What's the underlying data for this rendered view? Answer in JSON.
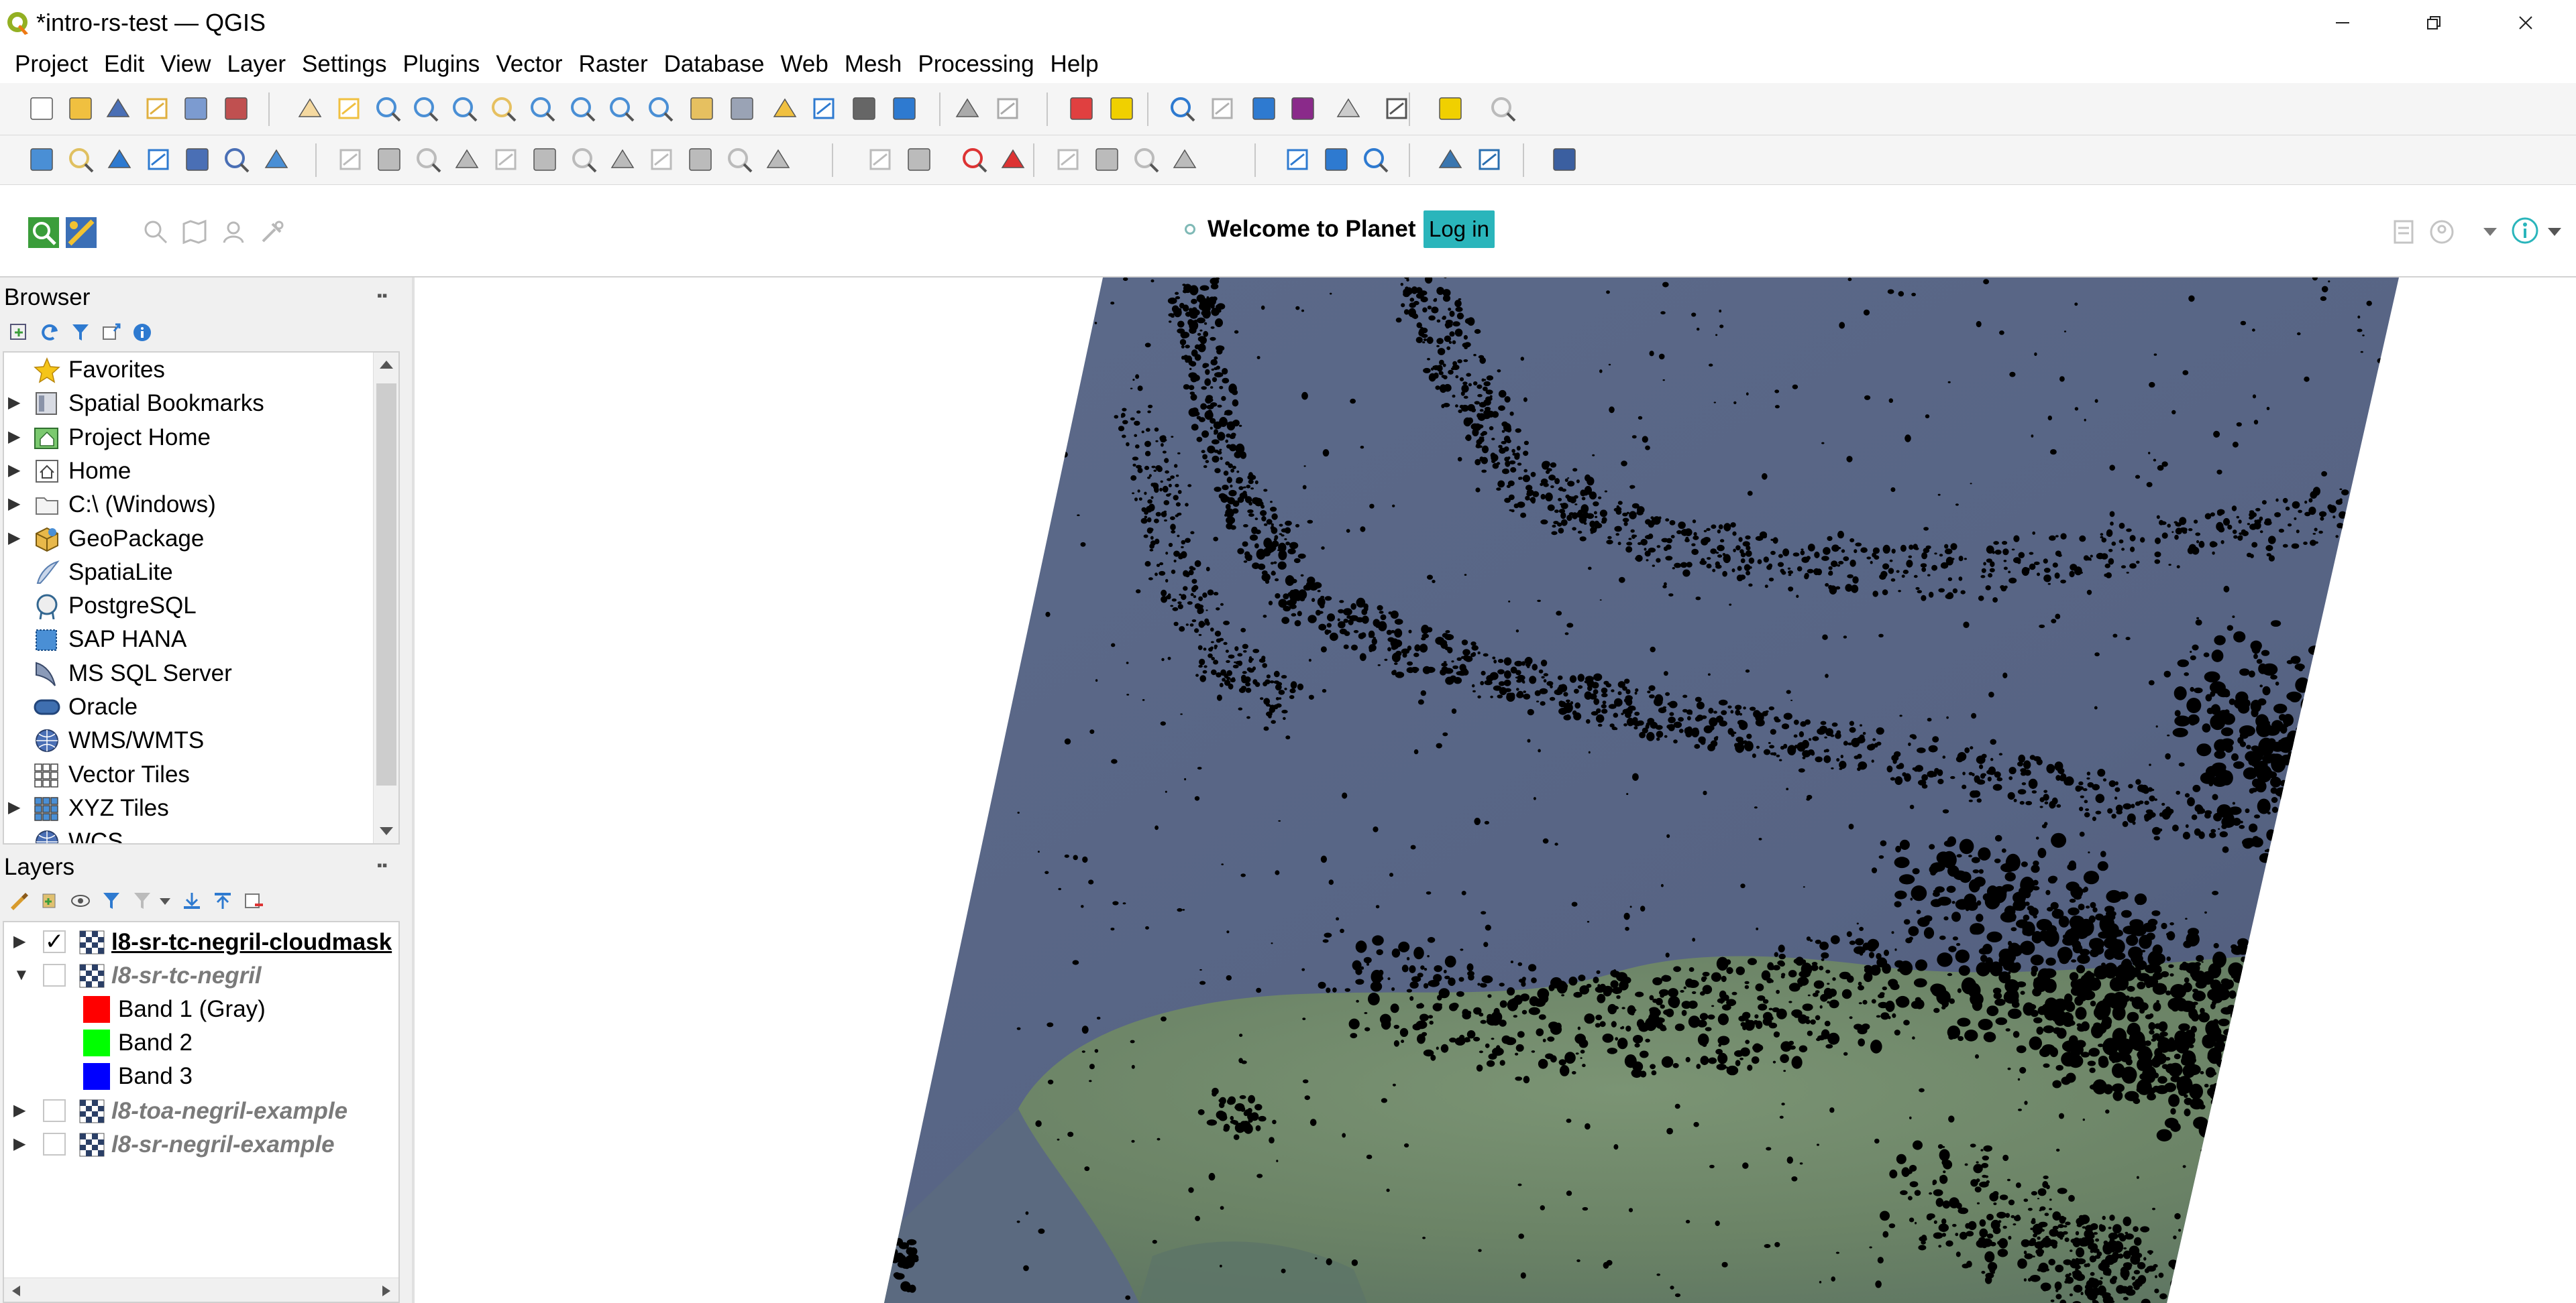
{
  "window": {
    "title": "*intro-rs-test — QGIS",
    "minimize_icon": "minimize-icon",
    "maximize_icon": "restore-icon",
    "close_icon": "close-icon"
  },
  "menu": [
    "Project",
    "Edit",
    "View",
    "Layer",
    "Settings",
    "Plugins",
    "Vector",
    "Raster",
    "Database",
    "Web",
    "Mesh",
    "Processing",
    "Help"
  ],
  "toolbar1_icons": [
    "new-project-icon",
    "open-project-icon",
    "save-project-icon",
    "save-as-icon",
    "print-layout-icon",
    "style-manager-icon",
    "pan-icon",
    "pan-to-selection-icon",
    "zoom-in-icon",
    "zoom-out-icon",
    "zoom-full-icon",
    "zoom-to-selection-icon",
    "zoom-to-layer-icon",
    "zoom-native-icon",
    "zoom-last-icon",
    "zoom-next-icon",
    "new-map-view-icon",
    "new-3d-view-icon",
    "new-bookmark-icon",
    "show-bookmarks-icon",
    "temporal-controller-icon",
    "refresh-icon",
    "select-features-icon",
    "select-by-value-icon",
    "deselect-icon",
    "select-location-icon",
    "identify-icon",
    "attribute-table-icon",
    "processing-toolbox-icon",
    "statistics-icon",
    "field-calculator-icon",
    "measure-icon",
    "map-tips-icon",
    "locator-icon"
  ],
  "toolbar2_icons": [
    "data-source-manager-icon",
    "new-geopackage-icon",
    "new-shapefile-icon",
    "digitize-icon",
    "new-virtual-layer-icon",
    "new-temp-layer-icon",
    "new-mesh-icon",
    "edit-pencil-icon",
    "toggle-editing-icon",
    "save-edits-icon",
    "add-feature-icon",
    "vertex-tool-icon",
    "modify-attributes-icon",
    "delete-selected-icon",
    "cut-features-icon",
    "copy-features-icon",
    "paste-features-icon",
    "undo-icon",
    "redo-icon",
    "label-toolbar-icon",
    "label-pin-icon",
    "label-highlight-icon",
    "label-change-icon",
    "label-rotate-icon",
    "label-show-icon",
    "label-move-icon",
    "label-edit-icon",
    "openlayers-icon",
    "qgis-cloud-icon",
    "metasearch-icon",
    "python-console-icon",
    "cloud-icon",
    "help-icon"
  ],
  "planet": {
    "welcome": "Welcome to Planet",
    "login": "Log in"
  },
  "browser": {
    "title": "Browser",
    "items": [
      {
        "label": "Favorites",
        "icon": "star-icon",
        "expandable": false
      },
      {
        "label": "Spatial Bookmarks",
        "icon": "bookmark-icon",
        "expandable": true
      },
      {
        "label": "Project Home",
        "icon": "project-home-icon",
        "expandable": true
      },
      {
        "label": "Home",
        "icon": "home-icon",
        "expandable": true
      },
      {
        "label": "C:\\ (Windows)",
        "icon": "drive-icon",
        "expandable": true
      },
      {
        "label": "GeoPackage",
        "icon": "geopackage-icon",
        "expandable": true
      },
      {
        "label": "SpatiaLite",
        "icon": "spatialite-icon",
        "expandable": false
      },
      {
        "label": "PostgreSQL",
        "icon": "postgresql-icon",
        "expandable": false
      },
      {
        "label": "SAP HANA",
        "icon": "sap-hana-icon",
        "expandable": false
      },
      {
        "label": "MS SQL Server",
        "icon": "mssql-icon",
        "expandable": false
      },
      {
        "label": "Oracle",
        "icon": "oracle-icon",
        "expandable": false
      },
      {
        "label": "WMS/WMTS",
        "icon": "wms-icon",
        "expandable": false
      },
      {
        "label": "Vector Tiles",
        "icon": "vector-tiles-icon",
        "expandable": false
      },
      {
        "label": "XYZ Tiles",
        "icon": "xyz-tiles-icon",
        "expandable": true
      },
      {
        "label": "WCS",
        "icon": "wcs-icon",
        "expandable": false
      }
    ]
  },
  "layers": {
    "title": "Layers",
    "items": [
      {
        "label": "l8-sr-tc-negril-cloudmask",
        "checked": true,
        "expanded": false,
        "active": true
      },
      {
        "label": "l8-sr-tc-negril",
        "checked": false,
        "expanded": true,
        "active": false
      },
      {
        "label": "l8-toa-negril-example",
        "checked": false,
        "expanded": false,
        "active": false
      },
      {
        "label": "l8-sr-negril-example",
        "checked": false,
        "expanded": false,
        "active": false
      }
    ],
    "bands": [
      {
        "label": "Band 1 (Gray)",
        "color": "#ff0000"
      },
      {
        "label": "Band 2",
        "color": "#00ff00"
      },
      {
        "label": "Band 3",
        "color": "#0000ff"
      }
    ]
  },
  "colors": {
    "accent": "#2ab5bb",
    "water": "#5a6787",
    "land": "#6f8a6b",
    "cloudmask": "#000000"
  }
}
